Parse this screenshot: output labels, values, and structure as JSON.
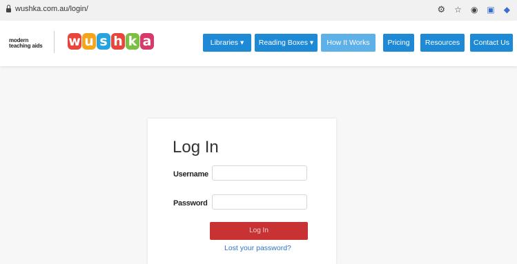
{
  "browser": {
    "url": "wushka.com.au/login/",
    "icons": [
      "key-icon",
      "star-icon",
      "extension-icon",
      "extension-icon",
      "extension-icon"
    ]
  },
  "header": {
    "mta_logo_lines": [
      "modern",
      "teaching aids"
    ],
    "brand_logo": {
      "letters": [
        "w",
        "u",
        "s",
        "h",
        "k",
        "a"
      ],
      "colors": [
        "#e8453c",
        "#f4a51c",
        "#27a3dd",
        "#e8453c",
        "#7cc043",
        "#d63a6a"
      ]
    },
    "nav": [
      {
        "label": "Libraries",
        "dropdown": true
      },
      {
        "label": "Reading Boxes",
        "dropdown": true
      },
      {
        "label": "How It Works",
        "dropdown": false
      },
      {
        "label": "Pricing",
        "dropdown": false
      },
      {
        "label": "Resources",
        "dropdown": false
      },
      {
        "label": "Contact Us",
        "dropdown": false
      }
    ]
  },
  "login": {
    "title": "Log In",
    "username_label": "Username",
    "username_value": "",
    "password_label": "Password",
    "password_value": "",
    "submit_label": "Log In",
    "lost_password": "Lost your password?"
  },
  "colors": {
    "nav_blue": "#1e8ad6",
    "nav_active": "#5eb0e8",
    "login_red": "#c93232",
    "link_blue": "#2f74c8"
  }
}
